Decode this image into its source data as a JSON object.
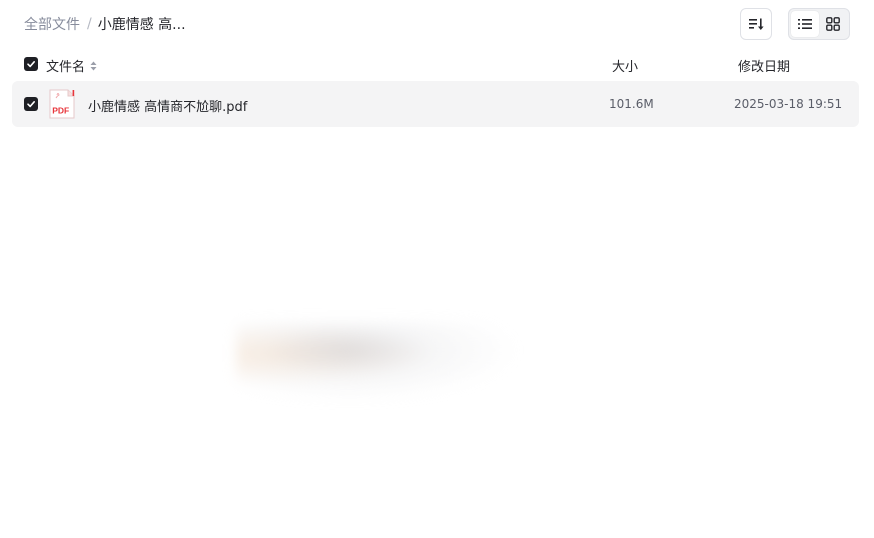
{
  "breadcrumb": {
    "root": "全部文件",
    "separator": "/",
    "current": "小鹿情感 高..."
  },
  "toolbar": {
    "sort_icon": "sort-lines-icon",
    "view_modes": [
      "list-view-icon",
      "grid-view-icon"
    ],
    "active_view": "list"
  },
  "table": {
    "headers": {
      "name": "文件名",
      "size": "大小",
      "modified": "修改日期"
    },
    "all_selected": true,
    "rows": [
      {
        "selected": true,
        "type": "pdf",
        "icon_label": "PDF",
        "name": "小鹿情感 高情商不尬聊.pdf",
        "size": "101.6M",
        "modified": "2025-03-18 19:51"
      }
    ]
  },
  "colors": {
    "checkbox": "#1e1f24",
    "row_highlight": "#f4f4f5",
    "pdf_red": "#e8353b",
    "muted_text": "#878c9c"
  }
}
